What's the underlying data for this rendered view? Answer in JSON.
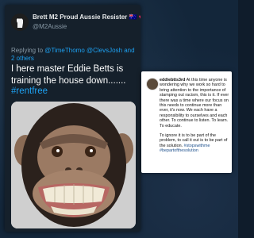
{
  "tweet": {
    "author_name": "Brett M2 Proud Aussie Resister",
    "author_handle": "@M2Aussie",
    "reply_prefix": "Replying to",
    "reply_users": "@TimeThomo @ClevsJosh and 2 others",
    "text": "I here master Eddie Betts is training the house down.......",
    "hashtag": "#rentfree",
    "media_alt": "chimpanzee-grinning-photo"
  },
  "instagram": {
    "username": "eddiebtts3rd",
    "caption_1": "At this time anyone is wondering why we work so hard to bring attention to the importance of stamping out racism, this is it. If ever there was a time where our focus on this needs to continue more than ever, it's now. We each have a responsibility to ourselves and each other. To continue to listen. To learn. To educate.",
    "caption_2": "To ignore it is to be part of the problem, to call it out is to be part of the solution.",
    "tags": "#stopswithme #bepartofthesolution"
  },
  "colors": {
    "tweet_bg": "#15202b",
    "link": "#1da1f2",
    "muted": "#8899a6",
    "heart": "#e0245e"
  }
}
